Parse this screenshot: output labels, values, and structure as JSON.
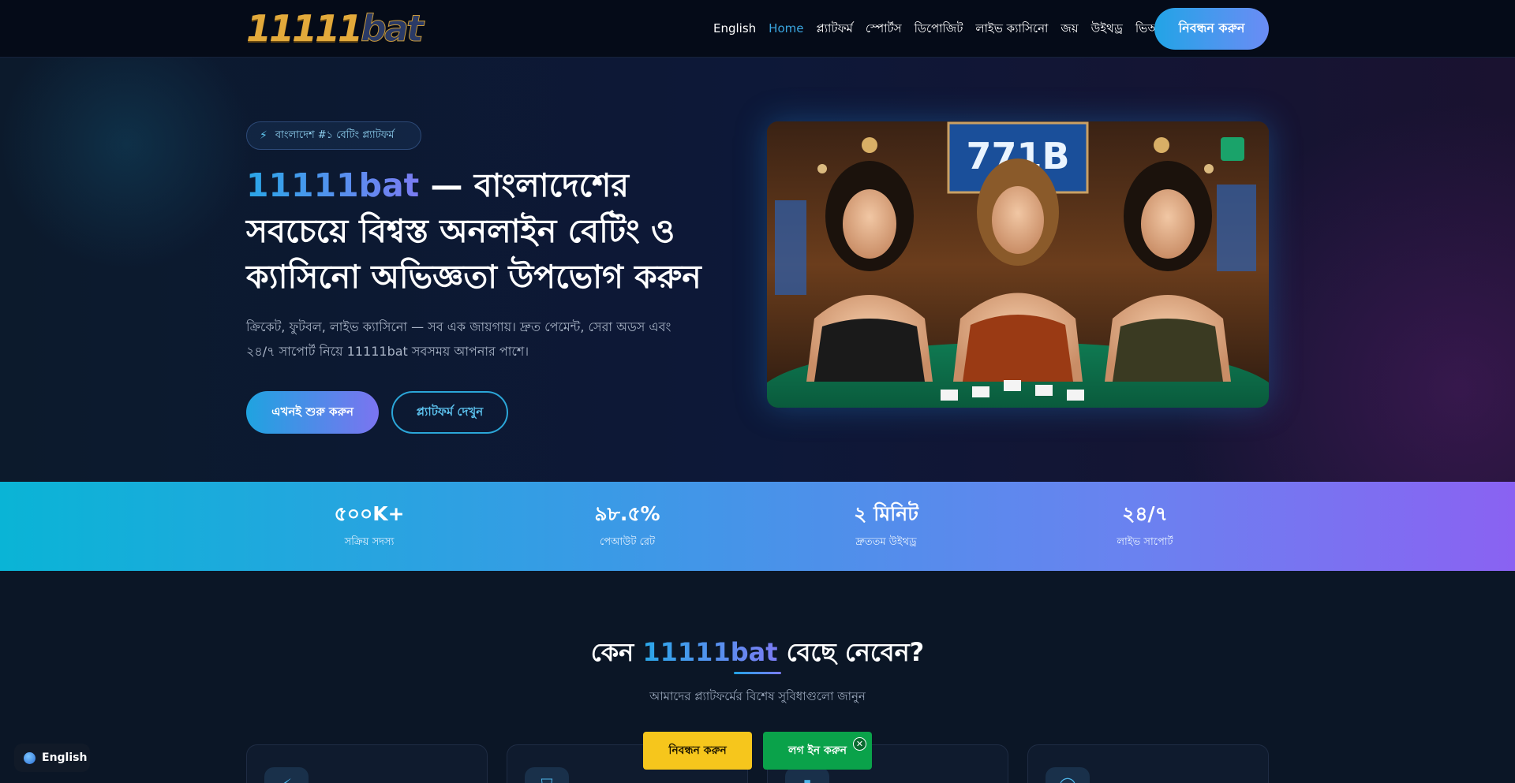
{
  "header": {
    "logo_text_num": "11111",
    "logo_text_bat": "bat",
    "nav": [
      {
        "label": "English"
      },
      {
        "label": "Home"
      },
      {
        "label": "প্ল্যাটফর্ম"
      },
      {
        "label": "স্পোর্টস"
      },
      {
        "label": "ডিপোজিট"
      },
      {
        "label": "লাইভ ক্যাসিনো"
      },
      {
        "label": "জয়"
      },
      {
        "label": "উইথড্র"
      },
      {
        "label": "ভিআইপি"
      }
    ],
    "register_label": "নিবন্ধন করুন"
  },
  "hero": {
    "badge_icon": "bolt-icon",
    "badge_text": "বাংলাদেশ #১ বেটিং প্ল্যাটফর্ম",
    "title_brand": "11111bat",
    "title_rest": " — বাংলাদেশের সবচেয়ে বিশ্বস্ত অনলাইন বেটিং ও ক্যাসিনো অভিজ্ঞতা উপভোগ করুন",
    "subtitle": "ক্রিকেট, ফুটবল, লাইভ ক্যাসিনো — সব এক জায়গায়। দ্রুত পেমেন্ট, সেরা অডস এবং ২৪/৭ সাপোর্ট নিয়ে 11111bat সবসময় আপনার পাশে।",
    "start_label": "এখনই শুরু করুন",
    "platform_label": "প্ল্যাটফর্ম দেখুন",
    "image_sign": "771B"
  },
  "stats": [
    {
      "value": "৫০০K+",
      "label": "সক্রিয় সদস্য"
    },
    {
      "value": "৯৮.৫%",
      "label": "পেআউট রেট"
    },
    {
      "value": "২ মিনিট",
      "label": "দ্রুততম উইথড্র"
    },
    {
      "value": "২৪/৭",
      "label": "লাইভ সাপোর্ট"
    }
  ],
  "why": {
    "title_pre": "কেন ",
    "title_brand": "11111bat",
    "title_post": " বেছে নেবেন?",
    "subtitle": "আমাদের প্ল্যাটফর্মের বিশেষ সুবিধাগুলো জানুন",
    "card_icons": [
      "bolt-icon",
      "shield-icon",
      "chart-icon",
      "headset-icon"
    ]
  },
  "floating": {
    "language": "English",
    "register_label": "নিবন্ধন করুন",
    "login_label": "লগ ইন করুন",
    "close_glyph": "✕"
  },
  "colors": {
    "accent_blue": "#22a4e6",
    "accent_purple": "#7b7cf3",
    "register_yellow": "#f6c61c",
    "login_green": "#0aa24a"
  }
}
